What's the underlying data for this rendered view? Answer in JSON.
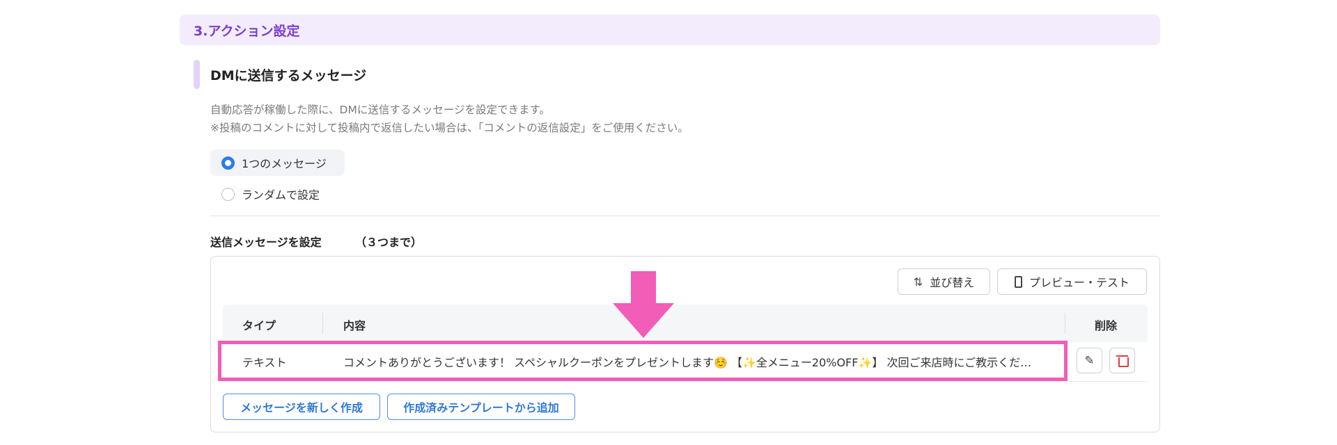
{
  "section": {
    "title": "3.アクション設定"
  },
  "dm": {
    "title": "DMに送信するメッセージ",
    "desc_line1": "自動応答が稼働した際に、DMに送信するメッセージを設定できます。",
    "desc_line2": "※投稿のコメントに対して投稿内で返信したい場合は、「コメントの返信設定」をご使用ください。"
  },
  "mode_options": [
    {
      "label": "1つのメッセージ",
      "selected": true
    },
    {
      "label": "ランダムで設定",
      "selected": false
    }
  ],
  "messages": {
    "label": "送信メッセージを設定",
    "limit": "（３つまで）",
    "toolbar": {
      "sort_label": "並び替え",
      "preview_label": "プレビュー・テスト"
    },
    "columns": {
      "type": "タイプ",
      "content": "内容",
      "delete": "削除"
    },
    "rows": [
      {
        "type": "テキスト",
        "content": "コメントありがとうございます！ スペシャルクーポンをプレゼントします☺️ 【✨全メニュー20%OFF✨】 次回ご来店時にご教示くだ…"
      }
    ],
    "actions": {
      "new_label": "メッセージを新しく作成",
      "template_label": "作成済みテンプレートから追加"
    }
  },
  "colors": {
    "accent": "#7b3fd0",
    "primary": "#2b7de9",
    "highlight": "#f25db7",
    "danger": "#e23b3b"
  },
  "icons": {
    "sort": "sort-arrows-icon",
    "preview": "smartphone-icon",
    "edit": "pencil-icon",
    "delete": "trash-icon",
    "annotation": "down-arrow-icon"
  }
}
